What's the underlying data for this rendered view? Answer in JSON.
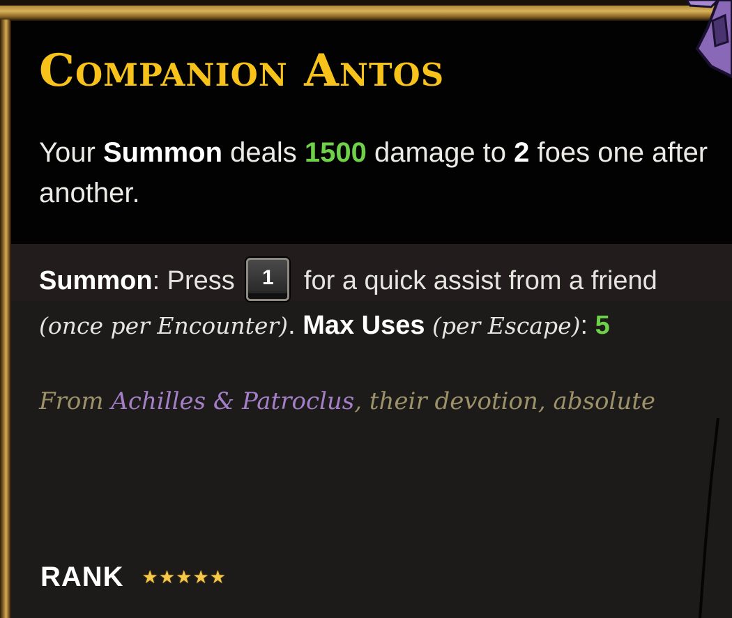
{
  "boon": {
    "title": "Companion Antos",
    "description": {
      "prefix": "Your ",
      "keyword": "Summon",
      "middle": " deals ",
      "damage": "1500",
      "after_damage": " damage to ",
      "foes": "2",
      "suffix": " foes one after another."
    },
    "summon_info": {
      "keyword": "Summon",
      "press_text": ": Press ",
      "key": "1",
      "assist_text": " for a quick assist from a friend ",
      "frequency": "(once per Encounter)",
      "period": ". ",
      "max_uses_label": "Max Uses",
      "max_uses_qualifier": " (per Escape)",
      "colon": ": ",
      "max_uses_value": "5"
    },
    "flavor": {
      "prefix": "From ",
      "names": "Achilles & Patroclus",
      "suffix": ", their devotion, absolute"
    },
    "rank": {
      "label": "RANK",
      "stars": "★★★★★",
      "value": 5
    }
  },
  "colors": {
    "title": "#f7c21a",
    "highlight_value": "#6fd04a",
    "flavor_text": "#9c9168",
    "flavor_names": "#a47fc8",
    "frame_gold": "#d4ad58"
  }
}
